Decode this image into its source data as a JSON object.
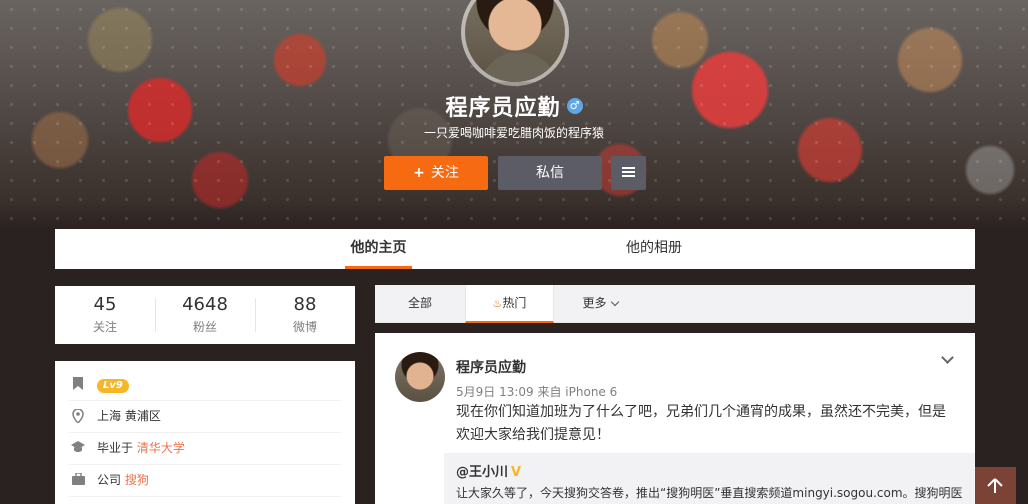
{
  "profile": {
    "name": "程序员应勤",
    "gender_symbol": "♂",
    "bio": "一只爱喝咖啡爱吃腊肉饭的程序猿",
    "follow_label": "关注",
    "follow_plus": "+",
    "message_label": "私信",
    "menu_icon": "menu-icon"
  },
  "tabs": {
    "home": "他的主页",
    "album": "他的相册"
  },
  "stats": [
    {
      "num": "45",
      "label": "关注"
    },
    {
      "num": "4648",
      "label": "粉丝"
    },
    {
      "num": "88",
      "label": "微博"
    }
  ],
  "info": {
    "level": "Lv9",
    "location": "上海 黄浦区",
    "edu_prefix": "毕业于",
    "edu_school": "清华大学",
    "company_prefix": "公司",
    "company_name": "搜狗"
  },
  "feed_tabs": {
    "all": "全部",
    "hot": "热门",
    "more": "更多"
  },
  "post": {
    "user": "程序员应勤",
    "meta": "5月9日 13:09 来自 iPhone 6",
    "text": "现在你们知道加班为了什么了吧，兄弟们几个通宵的成果，虽然还不完美，但是欢迎大家给我们提意见！",
    "repost_user": "@王小川",
    "repost_badge": "V",
    "repost_text": "让大家久等了，今天搜狗交答卷，推出“搜狗明医”垂直搜索频道mingyi.sogou.com。搜狗明医"
  },
  "colors": {
    "accent": "#f66a12",
    "link": "#eb7350"
  }
}
